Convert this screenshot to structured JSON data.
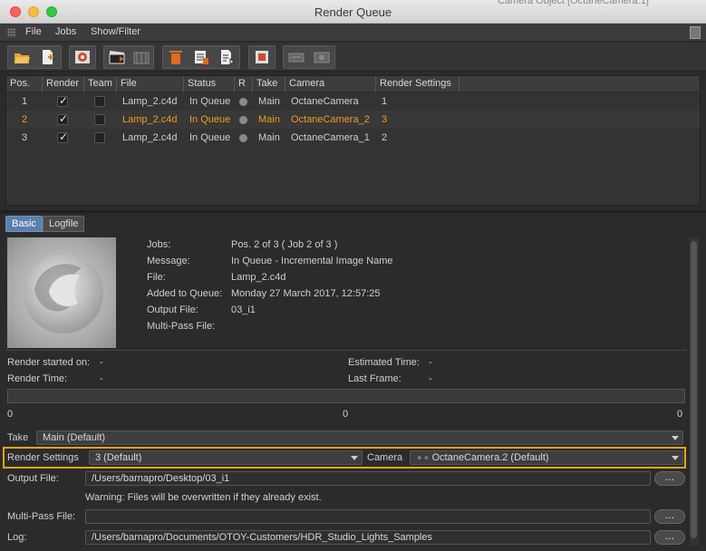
{
  "window": {
    "title": "Render Queue",
    "background_title": "Camera Object [OctaneCamera.1]"
  },
  "menu": {
    "items": [
      "File",
      "Jobs",
      "Show/Filter"
    ]
  },
  "toolbar": {
    "icons": [
      "open-file-icon",
      "add-file-icon",
      "render-view-icon",
      "start-render-icon",
      "render-all-icon",
      "delete-icon",
      "delete-all-icon",
      "edit-icon",
      "stop-icon",
      "network-icon",
      "camera-icon"
    ]
  },
  "queue": {
    "headers": [
      "Pos.",
      "Render",
      "Team",
      "File",
      "Status",
      "R",
      "Take",
      "Camera",
      "Render Settings"
    ],
    "rows": [
      {
        "pos": "1",
        "render": true,
        "team": false,
        "file": "Lamp_2.c4d",
        "status": "In Queue",
        "take": "Main",
        "camera": "OctaneCamera",
        "settings": "1",
        "selected": false
      },
      {
        "pos": "2",
        "render": true,
        "team": false,
        "file": "Lamp_2.c4d",
        "status": "In Queue",
        "take": "Main",
        "camera": "OctaneCamera_2",
        "settings": "3",
        "selected": true
      },
      {
        "pos": "3",
        "render": true,
        "team": false,
        "file": "Lamp_2.c4d",
        "status": "In Queue",
        "take": "Main",
        "camera": "OctaneCamera_1",
        "settings": "2",
        "selected": false
      }
    ]
  },
  "tabs": {
    "basic": "Basic",
    "logfile": "Logfile"
  },
  "info": {
    "jobs_label": "Jobs:",
    "jobs_value": "Pos. 2 of 3 ( Job 2 of 3 )",
    "message_label": "Message:",
    "message_value": "In Queue - Incremental Image Name",
    "file_label": "File:",
    "file_value": "Lamp_2.c4d",
    "added_label": "Added to Queue:",
    "added_value": "Monday 27 March 2017, 12:57:25",
    "output_label": "Output File:",
    "output_value": "03_i1",
    "multipass_label": "Multi-Pass File:"
  },
  "stats": {
    "started_label": "Render started on:",
    "started_value": "-",
    "time_label": "Render Time:",
    "time_value": "-",
    "estimated_label": "Estimated Time:",
    "estimated_value": "-",
    "last_frame_label": "Last Frame:",
    "last_frame_value": "-",
    "progress_fraction": 0,
    "progress_left": "0",
    "progress_mid": "0",
    "progress_right": "0"
  },
  "settings": {
    "take_label": "Take",
    "take_value": "Main (Default)",
    "render_settings_label": "Render Settings",
    "render_settings_value": "3 (Default)",
    "camera_label": "Camera",
    "camera_value": "OctaneCamera.2 (Default)",
    "output_label": "Output File:",
    "output_value": "/Users/barnapro/Desktop/03_i1",
    "warning": "Warning: Files will be overwritten if they already exist.",
    "multipass_label": "Multi-Pass File:",
    "multipass_value": "",
    "log_label": "Log:",
    "log_value": "/Users/barnapro/Documents/OTOY-Customers/HDR_Studio_Lights_Samples",
    "browse": "..."
  },
  "colors": {
    "accent": "#f59a1b",
    "tab_active": "#5b7fae"
  }
}
